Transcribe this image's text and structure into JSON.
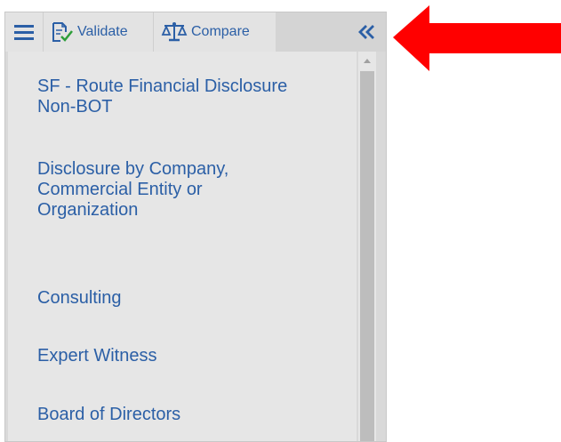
{
  "toolbar": {
    "menu_icon": "hamburger-menu-icon",
    "validate_label": "Validate",
    "validate_icon": "document-check-icon",
    "compare_label": "Compare",
    "compare_icon": "balance-scale-icon",
    "collapse_label": "«",
    "collapse_icon": "double-chevron-left-icon"
  },
  "nav": {
    "items": [
      {
        "label": "SF - Route Financial Disclosure Non-BOT"
      },
      {
        "label": "Disclosure by Company, Commercial Entity or Organization"
      },
      {
        "label": "Consulting"
      },
      {
        "label": "Expert Witness"
      },
      {
        "label": "Board of Directors"
      }
    ]
  },
  "annotation": {
    "arrow_color": "#ff0000",
    "arrow_icon": "red-pointer-arrow-icon"
  },
  "colors": {
    "link": "#2b5fa6",
    "panel_bg": "#e6e6e6",
    "toolbar_bg": "#d4d4d4"
  }
}
